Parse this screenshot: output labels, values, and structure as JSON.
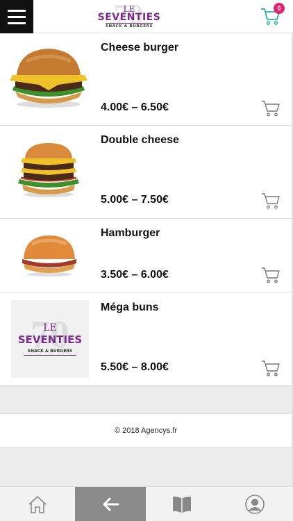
{
  "header": {
    "menu_icon": "hamburger-menu-icon",
    "logo": {
      "bg_text": "70",
      "le": "LE",
      "name": "SEVENTIES",
      "tagline": "SNACK & BURGERS"
    },
    "cart_icon": "shopping-cart-icon",
    "cart_count": "0"
  },
  "products": [
    {
      "name": "Cheese burger",
      "price": "4.00€ – 6.50€",
      "image": "cheeseburger"
    },
    {
      "name": "Double cheese",
      "price": "5.00€ – 7.50€",
      "image": "double-cheeseburger"
    },
    {
      "name": "Hamburger",
      "price": "3.50€ – 6.00€",
      "image": "hamburger"
    },
    {
      "name": "Méga buns",
      "price": "5.50€ – 8.00€",
      "image": "seventies-logo"
    }
  ],
  "footer": {
    "copyright": "© 2018 Agencys.fr"
  },
  "bottom_nav": [
    {
      "icon": "home-icon"
    },
    {
      "icon": "back-arrow-icon",
      "active": true
    },
    {
      "icon": "book-icon"
    },
    {
      "icon": "user-icon"
    }
  ],
  "colors": {
    "accent_cart": "#2ab0a8",
    "badge": "#e2226b",
    "brand_purple": "#7a2a8a",
    "nav_active": "#8a8a8a"
  }
}
